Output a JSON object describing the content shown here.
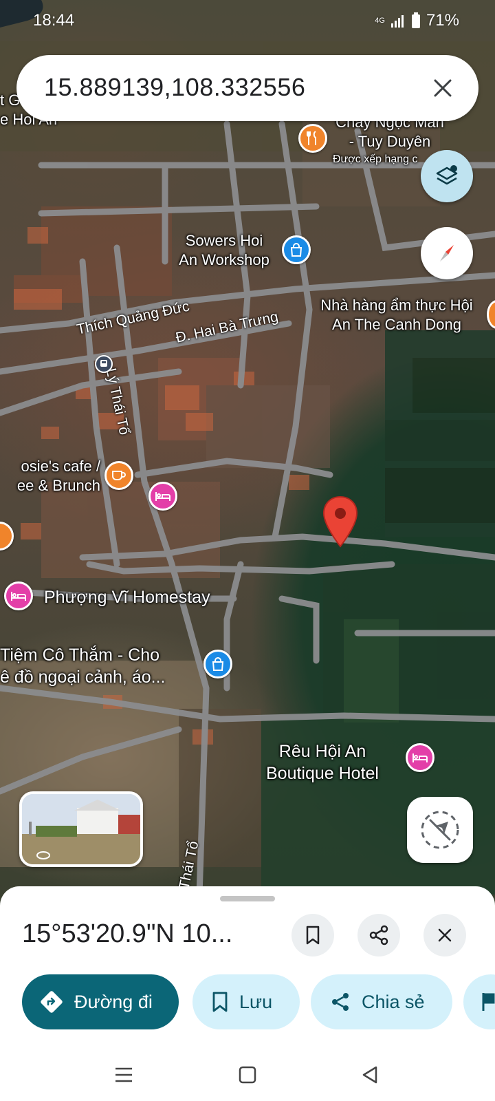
{
  "status_bar": {
    "time": "18:44",
    "network": "4G",
    "battery": "71%"
  },
  "search": {
    "query": "15.889139,108.332556"
  },
  "map": {
    "poi_labels": [
      {
        "text": "Sowers Hoi\nAn Workshop",
        "icon": "shopping-bag-icon"
      },
      {
        "text": "Nhà hàng ẩm thực Hội\nAn The Canh Dong",
        "icon": "restaurant-icon"
      },
      {
        "text": "Chay Ngọc Mẫn\n- Tuy Duyên",
        "icon": "restaurant-icon"
      },
      {
        "text": "osie's cafe /\nee & Brunch",
        "icon": "cafe-icon"
      },
      {
        "text": "Phượng Vĩ Homestay",
        "icon": "hotel-icon"
      },
      {
        "text": "Tiệm Cô Thắm - Cho\nê đồ ngoại cảnh, áo...",
        "icon": "shopping-bag-icon"
      },
      {
        "text": "Rêu Hội An\nBoutique Hotel",
        "icon": "hotel-icon"
      }
    ],
    "partial_labels": {
      "top_left_1": "t G",
      "top_left_2": "e Hoi An",
      "rating_note": "Được xếp hạng c"
    },
    "streets": {
      "thich_quang_duc": "Thích Quảng Đức",
      "hai_ba_trung": "Đ. Hai Bà Trưng",
      "ly_thai_to": "Lý Thái Tổ",
      "thai_to": "Thái Tổ"
    }
  },
  "sheet": {
    "title": "15°53'20.9\"N 10...",
    "actions": {
      "directions": "Đường đi",
      "save": "Lưu",
      "share": "Chia sẻ"
    }
  },
  "colors": {
    "primary_chip": "#0b6677",
    "secondary_chip": "#d4f1fb",
    "pin": "#ea4335"
  }
}
